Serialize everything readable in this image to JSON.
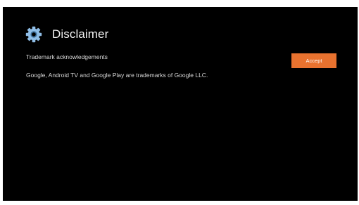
{
  "header": {
    "title": "Disclaimer",
    "icon": "gear-icon"
  },
  "content": {
    "subtitle": "Trademark acknowledgements",
    "body": "Google, Android TV and Google Play are trademarks of Google LLC."
  },
  "actions": {
    "accept_label": "Accept"
  },
  "colors": {
    "background": "#000000",
    "accent": "#e8722f",
    "icon": "#8fbde6"
  }
}
